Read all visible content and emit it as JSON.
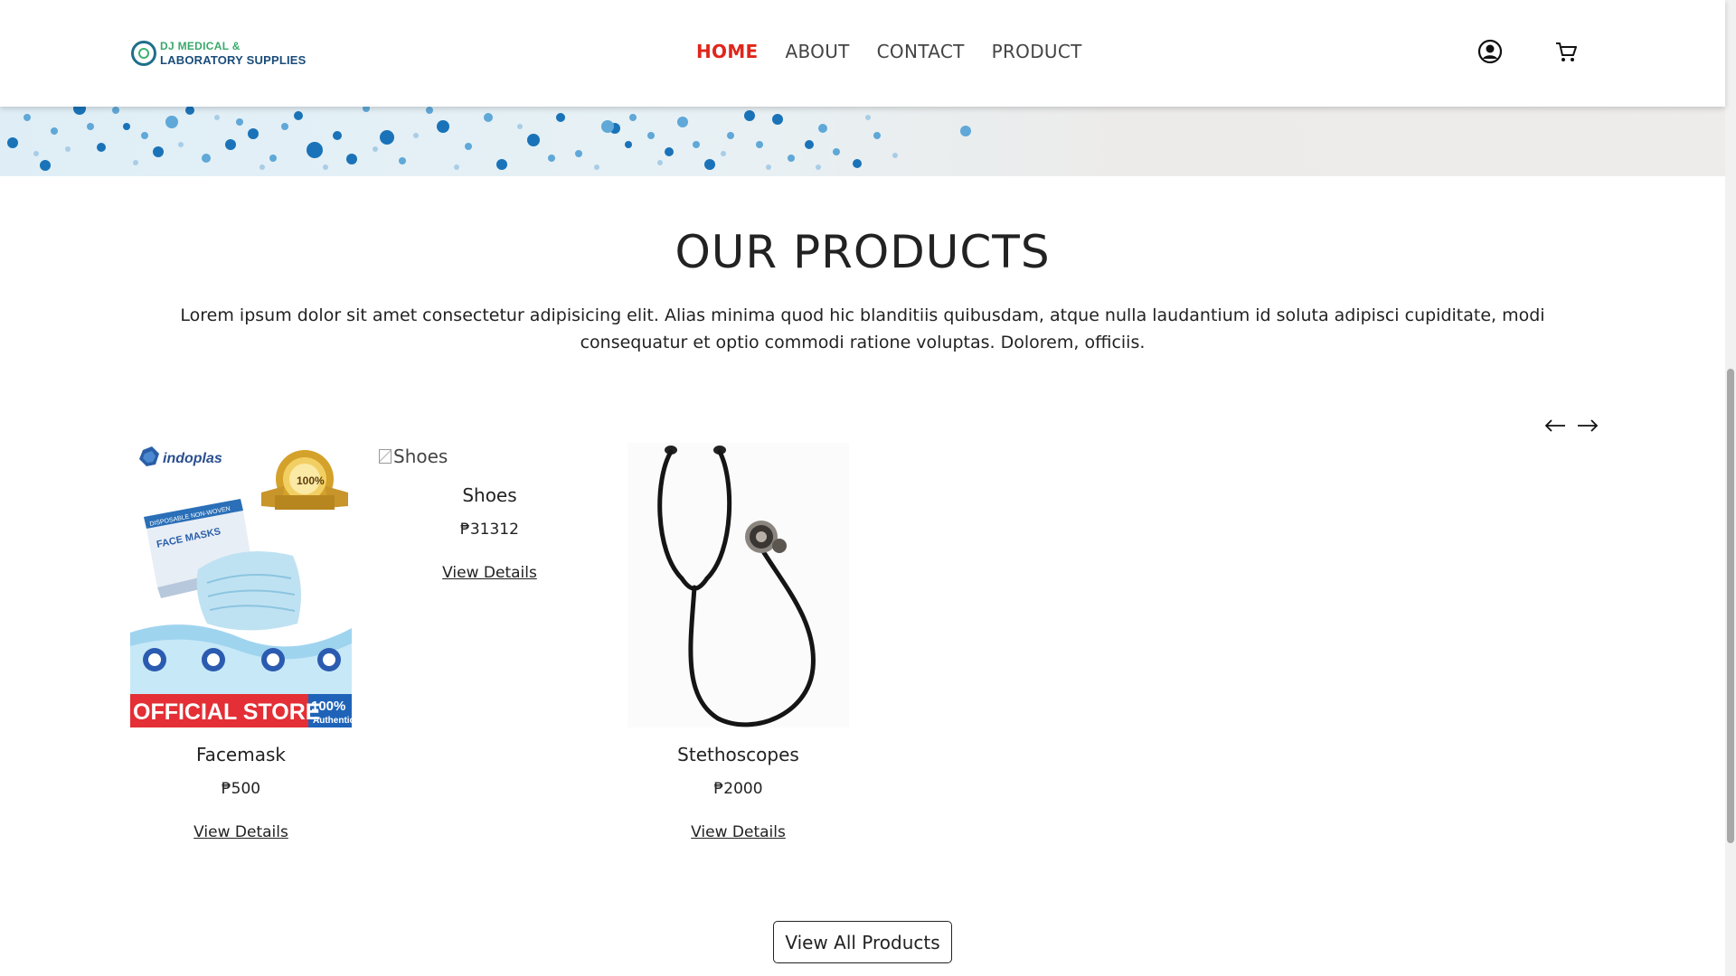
{
  "brand": {
    "line1": "DJ MEDICAL &",
    "line2": "LABORATORY SUPPLIES",
    "colors": {
      "green": "#3aa86b",
      "blue": "#1a4c7a"
    }
  },
  "nav": {
    "items": [
      {
        "label": "HOME",
        "active": true
      },
      {
        "label": "ABOUT",
        "active": false
      },
      {
        "label": "CONTACT",
        "active": false
      },
      {
        "label": "PRODUCT",
        "active": false
      }
    ],
    "active_color": "#e0261b"
  },
  "header_icons": [
    "user-icon",
    "cart-icon"
  ],
  "section": {
    "title": "OUR PRODUCTS",
    "description": "Lorem ipsum dolor sit amet consectetur adipisicing elit. Alias minima quod hic blanditiis quibusdam, atque nulla laudantium id soluta adipisci cupiditate, modi consequatur et optio commodi ratione voluptas. Dolorem, officiis."
  },
  "carousel": {
    "prev_icon": "arrow-left-icon",
    "next_icon": "arrow-right-icon"
  },
  "products": [
    {
      "name": "Facemask",
      "price": "₱500",
      "link": "View Details",
      "image": {
        "brand": "indoplas",
        "box_label": "FACE MASKS",
        "box_subtitle": "DISPOSABLE NON-WOVEN",
        "seal": "100%",
        "banner_main": "OFFICIAL STORE",
        "banner_badge_top": "100%",
        "banner_badge_bottom": "Authentic"
      }
    },
    {
      "name": "Shoes",
      "price": "₱31312",
      "link": "View Details",
      "broken_image_alt": "Shoes"
    },
    {
      "name": "Stethoscopes",
      "price": "₱2000",
      "link": "View Details"
    }
  ],
  "view_all": {
    "label": "View All Products"
  }
}
